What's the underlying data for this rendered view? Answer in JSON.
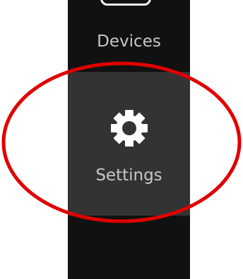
{
  "charms": {
    "devices": {
      "label": "Devices",
      "icon": "devices-icon"
    },
    "settings": {
      "label": "Settings",
      "icon": "gear-icon"
    }
  },
  "colors": {
    "bar_background": "#111111",
    "selected_background": "#333333",
    "label_text": "#c8c8c8",
    "icon": "#ffffff",
    "annotation": "#e00000"
  }
}
